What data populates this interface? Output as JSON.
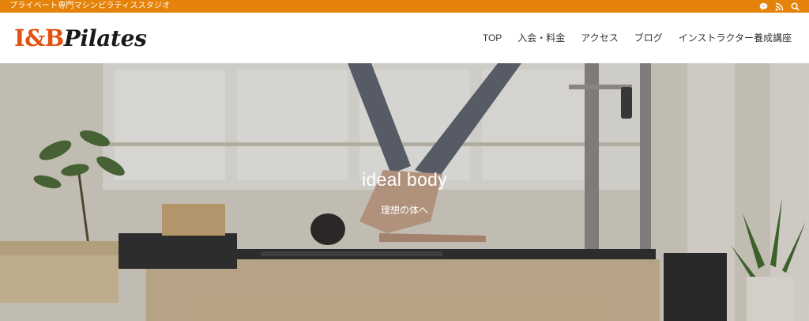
{
  "topbar": {
    "tagline": "プライベート専門マシンピラティススタジオ",
    "icons": [
      "chat-icon",
      "rss-icon",
      "search-icon"
    ],
    "background": "#e5820a"
  },
  "header": {
    "logo_mark": "I&B",
    "logo_word": "Pilates",
    "logo_color": "#e5500f",
    "nav": [
      {
        "label": "TOP"
      },
      {
        "label": "入会・料金"
      },
      {
        "label": "アクセス"
      },
      {
        "label": "ブログ"
      },
      {
        "label": "インストラクター養成講座"
      }
    ]
  },
  "hero": {
    "title": "ideal body",
    "subtitle": "理想の体へ"
  }
}
